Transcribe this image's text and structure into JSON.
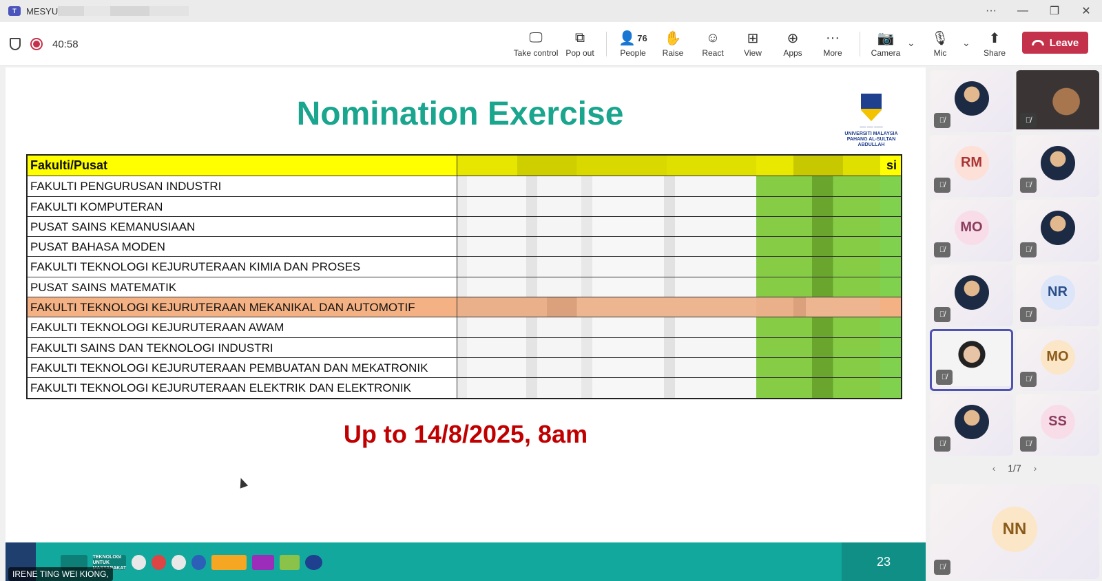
{
  "window": {
    "title": "MESYU"
  },
  "toolbar": {
    "timer": "40:58",
    "take_control": "Take control",
    "pop_out": "Pop out",
    "people": "People",
    "people_count": "76",
    "raise": "Raise",
    "react": "React",
    "view": "View",
    "apps": "Apps",
    "more": "More",
    "camera": "Camera",
    "mic": "Mic",
    "share": "Share",
    "leave": "Leave",
    "leave_color": "#c4314b"
  },
  "slide": {
    "title": "Nomination Exercise",
    "logo_text": "UNIVERSITI MALAYSIA PAHANG AL-SULTAN ABDULLAH",
    "table_header": "Fakulti/Pusat",
    "table_header_tail": "si",
    "rows": [
      "FAKULTI PENGURUSAN INDUSTRI",
      "FAKULTI KOMPUTERAN",
      "PUSAT SAINS KEMANUSIAAN",
      "PUSAT BAHASA MODEN",
      "FAKULTI TEKNOLOGI KEJURUTERAAN KIMIA DAN PROSES",
      "PUSAT SAINS MATEMATIK",
      "FAKULTI TEKNOLOGI KEJURUTERAAN MEKANIKAL DAN AUTOMOTIF",
      "FAKULTI TEKNOLOGI KEJURUTERAAN AWAM",
      "FAKULTI SAINS DAN TEKNOLOGI INDUSTRI",
      "FAKULTI TEKNOLOGI KEJURUTERAAN PEMBUATAN DAN MEKATRONIK",
      "FAKULTI TEKNOLOGI KEJURUTERAAN ELEKTRIK DAN ELEKTRONIK"
    ],
    "highlighted_row": "FAKULTI TEKNOLOGI KEJURUTERAAN MEKANIKAL DAN AUTOMOTIF",
    "deadline": "Up to 14/8/2025, 8am",
    "footer_slogan": "TEKNOLOGI UNTUK MASYARAKAT",
    "page_number": "23",
    "title_color": "#1aa58e",
    "deadline_color": "#c00000"
  },
  "speaker": {
    "name": "IRENE TING WEI KIONG,"
  },
  "participants": [
    {
      "initials": "",
      "type": "photo"
    },
    {
      "initials": "",
      "type": "photo"
    },
    {
      "initials": "RM",
      "type": "initials"
    },
    {
      "initials": "",
      "type": "photo"
    },
    {
      "initials": "MO",
      "type": "initials"
    },
    {
      "initials": "",
      "type": "photo"
    },
    {
      "initials": "",
      "type": "photo"
    },
    {
      "initials": "NR",
      "type": "initials"
    },
    {
      "initials": "",
      "type": "photo-active"
    },
    {
      "initials": "MO",
      "type": "initials"
    },
    {
      "initials": "",
      "type": "photo"
    },
    {
      "initials": "SS",
      "type": "initials"
    }
  ],
  "pager": {
    "label": "1/7"
  },
  "featured": {
    "initials": "NN"
  }
}
